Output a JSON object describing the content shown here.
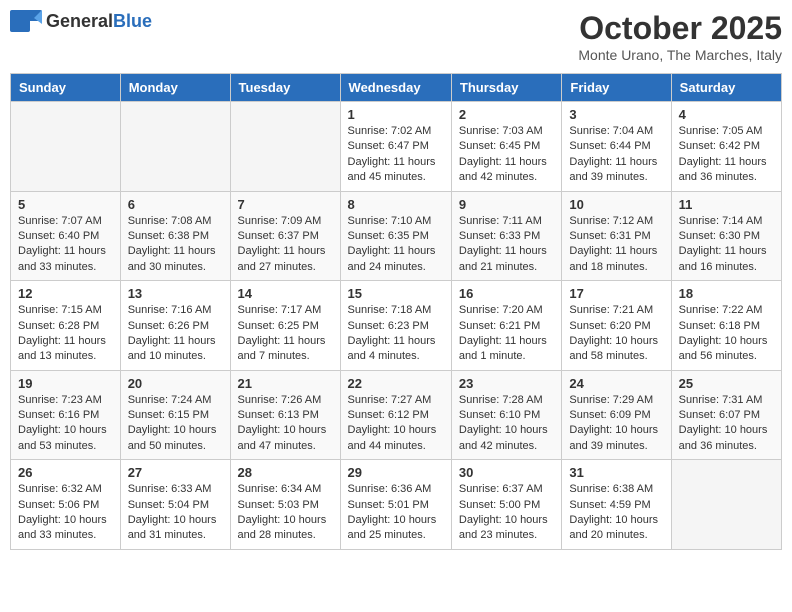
{
  "logo": {
    "general": "General",
    "blue": "Blue"
  },
  "title": {
    "month_year": "October 2025",
    "location": "Monte Urano, The Marches, Italy"
  },
  "days_of_week": [
    "Sunday",
    "Monday",
    "Tuesday",
    "Wednesday",
    "Thursday",
    "Friday",
    "Saturday"
  ],
  "weeks": [
    {
      "days": [
        {
          "day": "",
          "content": ""
        },
        {
          "day": "",
          "content": ""
        },
        {
          "day": "",
          "content": ""
        },
        {
          "day": "1",
          "content": "Sunrise: 7:02 AM\nSunset: 6:47 PM\nDaylight: 11 hours and 45 minutes."
        },
        {
          "day": "2",
          "content": "Sunrise: 7:03 AM\nSunset: 6:45 PM\nDaylight: 11 hours and 42 minutes."
        },
        {
          "day": "3",
          "content": "Sunrise: 7:04 AM\nSunset: 6:44 PM\nDaylight: 11 hours and 39 minutes."
        },
        {
          "day": "4",
          "content": "Sunrise: 7:05 AM\nSunset: 6:42 PM\nDaylight: 11 hours and 36 minutes."
        }
      ]
    },
    {
      "days": [
        {
          "day": "5",
          "content": "Sunrise: 7:07 AM\nSunset: 6:40 PM\nDaylight: 11 hours and 33 minutes."
        },
        {
          "day": "6",
          "content": "Sunrise: 7:08 AM\nSunset: 6:38 PM\nDaylight: 11 hours and 30 minutes."
        },
        {
          "day": "7",
          "content": "Sunrise: 7:09 AM\nSunset: 6:37 PM\nDaylight: 11 hours and 27 minutes."
        },
        {
          "day": "8",
          "content": "Sunrise: 7:10 AM\nSunset: 6:35 PM\nDaylight: 11 hours and 24 minutes."
        },
        {
          "day": "9",
          "content": "Sunrise: 7:11 AM\nSunset: 6:33 PM\nDaylight: 11 hours and 21 minutes."
        },
        {
          "day": "10",
          "content": "Sunrise: 7:12 AM\nSunset: 6:31 PM\nDaylight: 11 hours and 18 minutes."
        },
        {
          "day": "11",
          "content": "Sunrise: 7:14 AM\nSunset: 6:30 PM\nDaylight: 11 hours and 16 minutes."
        }
      ]
    },
    {
      "days": [
        {
          "day": "12",
          "content": "Sunrise: 7:15 AM\nSunset: 6:28 PM\nDaylight: 11 hours and 13 minutes."
        },
        {
          "day": "13",
          "content": "Sunrise: 7:16 AM\nSunset: 6:26 PM\nDaylight: 11 hours and 10 minutes."
        },
        {
          "day": "14",
          "content": "Sunrise: 7:17 AM\nSunset: 6:25 PM\nDaylight: 11 hours and 7 minutes."
        },
        {
          "day": "15",
          "content": "Sunrise: 7:18 AM\nSunset: 6:23 PM\nDaylight: 11 hours and 4 minutes."
        },
        {
          "day": "16",
          "content": "Sunrise: 7:20 AM\nSunset: 6:21 PM\nDaylight: 11 hours and 1 minute."
        },
        {
          "day": "17",
          "content": "Sunrise: 7:21 AM\nSunset: 6:20 PM\nDaylight: 10 hours and 58 minutes."
        },
        {
          "day": "18",
          "content": "Sunrise: 7:22 AM\nSunset: 6:18 PM\nDaylight: 10 hours and 56 minutes."
        }
      ]
    },
    {
      "days": [
        {
          "day": "19",
          "content": "Sunrise: 7:23 AM\nSunset: 6:16 PM\nDaylight: 10 hours and 53 minutes."
        },
        {
          "day": "20",
          "content": "Sunrise: 7:24 AM\nSunset: 6:15 PM\nDaylight: 10 hours and 50 minutes."
        },
        {
          "day": "21",
          "content": "Sunrise: 7:26 AM\nSunset: 6:13 PM\nDaylight: 10 hours and 47 minutes."
        },
        {
          "day": "22",
          "content": "Sunrise: 7:27 AM\nSunset: 6:12 PM\nDaylight: 10 hours and 44 minutes."
        },
        {
          "day": "23",
          "content": "Sunrise: 7:28 AM\nSunset: 6:10 PM\nDaylight: 10 hours and 42 minutes."
        },
        {
          "day": "24",
          "content": "Sunrise: 7:29 AM\nSunset: 6:09 PM\nDaylight: 10 hours and 39 minutes."
        },
        {
          "day": "25",
          "content": "Sunrise: 7:31 AM\nSunset: 6:07 PM\nDaylight: 10 hours and 36 minutes."
        }
      ]
    },
    {
      "days": [
        {
          "day": "26",
          "content": "Sunrise: 6:32 AM\nSunset: 5:06 PM\nDaylight: 10 hours and 33 minutes."
        },
        {
          "day": "27",
          "content": "Sunrise: 6:33 AM\nSunset: 5:04 PM\nDaylight: 10 hours and 31 minutes."
        },
        {
          "day": "28",
          "content": "Sunrise: 6:34 AM\nSunset: 5:03 PM\nDaylight: 10 hours and 28 minutes."
        },
        {
          "day": "29",
          "content": "Sunrise: 6:36 AM\nSunset: 5:01 PM\nDaylight: 10 hours and 25 minutes."
        },
        {
          "day": "30",
          "content": "Sunrise: 6:37 AM\nSunset: 5:00 PM\nDaylight: 10 hours and 23 minutes."
        },
        {
          "day": "31",
          "content": "Sunrise: 6:38 AM\nSunset: 4:59 PM\nDaylight: 10 hours and 20 minutes."
        },
        {
          "day": "",
          "content": ""
        }
      ]
    }
  ]
}
